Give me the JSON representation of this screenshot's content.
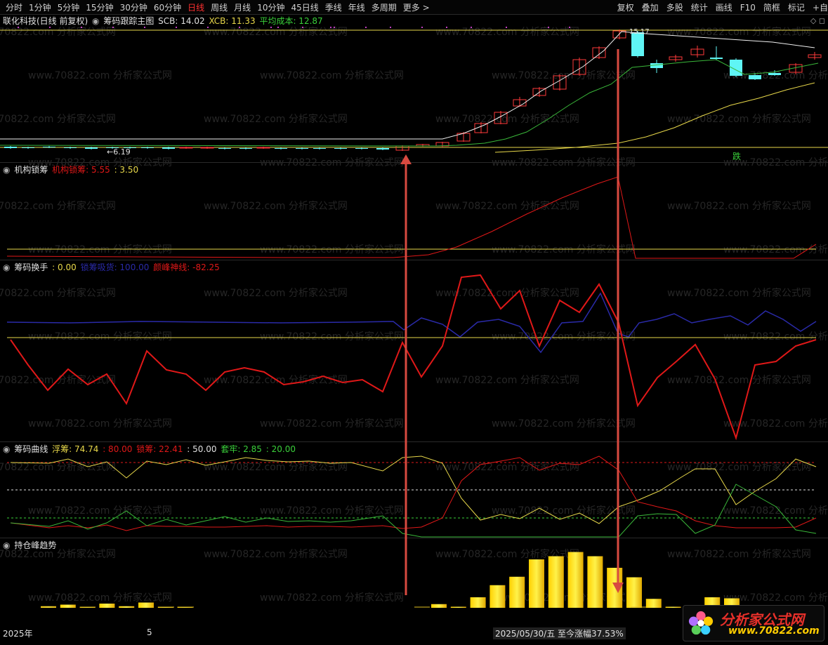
{
  "toolbar": {
    "periods": [
      "分时",
      "1分钟",
      "5分钟",
      "15分钟",
      "30分钟",
      "60分钟",
      "日线",
      "周线",
      "月线",
      "10分钟",
      "45日线",
      "季线",
      "年线",
      "多周期",
      "更多 >"
    ],
    "active_period": "日线",
    "tools": [
      "复权",
      "叠加",
      "多股",
      "统计",
      "画线",
      "F10",
      "简框",
      "标记",
      "+自"
    ]
  },
  "main_panel": {
    "stock": "联化科技(日线 前复权)",
    "indicator": "筹码跟踪主图",
    "scb": "SCB: 14.02",
    "xcb": "XCB: 11.33",
    "avg_cost": "平均成本: 12.87",
    "low_label": "6.19",
    "high_label": "15.17",
    "drop_label": "跌"
  },
  "panel_jgsc": {
    "name": "机构锁筹",
    "series1": "机构锁筹: 5.55",
    "series2": ": 3.50"
  },
  "panel_cmhs": {
    "name": "筹码换手",
    "v0": ": 0.00",
    "v1": "锁筹吸货: 100.00",
    "v2": "颜峰神线: -82.25"
  },
  "panel_cmqx": {
    "name": "筹码曲线",
    "v1": "浮筹: 74.74",
    "v2": ": 80.00",
    "v3": "锁筹: 22.41",
    "v4": ": 50.00",
    "v5": "套牢: 2.85",
    "v6": ": 20.00"
  },
  "panel_ccf": {
    "name": "持仓峰趋势"
  },
  "footer": {
    "year": "2025年",
    "month": "5",
    "date_info": "2025/05/30/五  至今涨幅37.53%"
  },
  "watermark": "www.70822.com 分析家公式网",
  "logo": {
    "title": "分析家公式网",
    "url": "www.70822.com"
  },
  "colors": {
    "up": "#ff3a3a",
    "down": "#5ff5f5",
    "yellow": "#e8d84a",
    "red_line": "#e01818",
    "blue_line": "#2a2aa8",
    "green_line": "#3ab83a",
    "arrow": "#d84a40"
  },
  "chart_data": [
    {
      "type": "line",
      "title": "机构锁筹",
      "series": [
        {
          "name": "机构锁筹",
          "values": [
            0.6,
            0.5,
            0.4,
            0.4,
            0.3,
            0.3,
            0.3,
            0.3,
            0.3,
            0.3,
            0.3,
            0.3,
            0.3,
            0.3,
            0.3,
            0.3,
            0.3,
            0.3,
            0.3,
            0.3,
            0.3,
            0.4,
            0.6,
            1.2,
            2.2,
            3.1,
            3.9,
            4.8,
            5.6,
            6.3,
            7.0,
            7.6,
            8.0,
            8.4,
            8.6,
            8.9,
            9.1,
            9.3,
            9.4,
            0.0,
            0.0,
            0.0,
            0.0,
            0.0,
            0.0,
            0.0,
            0.0,
            0.0,
            0.0,
            0.0,
            0.0,
            0.0,
            0.0,
            0.0,
            0.0,
            0.0,
            0.0,
            0.0,
            5.55
          ]
        },
        {
          "name": "",
          "values": [
            3.5
          ]
        }
      ]
    },
    {
      "type": "line",
      "title": "筹码换手",
      "series": [
        {
          "name": "锁筹吸货",
          "values": [
            100,
            100,
            100,
            100,
            100,
            100,
            100,
            100,
            100,
            100,
            100,
            100,
            100,
            100,
            100,
            100,
            100,
            100,
            100,
            100,
            95,
            100,
            100,
            90,
            85,
            95,
            100,
            100,
            90,
            85,
            100,
            100,
            95,
            90,
            100,
            95,
            88,
            100,
            100,
            90,
            95,
            100,
            100,
            95,
            100,
            100,
            90,
            100,
            95,
            100
          ]
        },
        {
          "name": "颜峰神线",
          "values": [
            -40,
            -30,
            -30,
            -30,
            -25,
            -35,
            -10,
            -40,
            -45,
            -30,
            -60,
            -55,
            -65,
            -75,
            -60,
            -50,
            -55,
            -65,
            -75,
            -55,
            -40,
            -35,
            -50,
            -55,
            -60,
            -55,
            -70,
            -75,
            -60,
            -80,
            -82.25
          ]
        }
      ]
    },
    {
      "type": "line",
      "title": "筹码曲线",
      "series": [
        {
          "name": "浮筹",
          "values": [
            74.74
          ]
        },
        {
          "name": "锁筹",
          "values": [
            22.41
          ]
        },
        {
          "name": "套牢",
          "values": [
            2.85
          ]
        }
      ]
    },
    {
      "type": "bar",
      "title": "持仓峰趋势",
      "values": [
        0.3,
        0.6,
        0.2,
        0.8,
        0.3,
        1.0,
        0.2,
        0.2,
        0,
        0,
        0,
        0,
        0,
        0,
        0,
        0,
        0,
        0,
        0,
        0,
        0.7,
        0.2,
        2.0,
        4.3,
        5.9,
        9.2,
        9.8,
        10.6,
        9.8,
        7.6,
        5.8,
        1.7,
        0.2,
        0,
        2.0,
        1.8
      ]
    }
  ]
}
